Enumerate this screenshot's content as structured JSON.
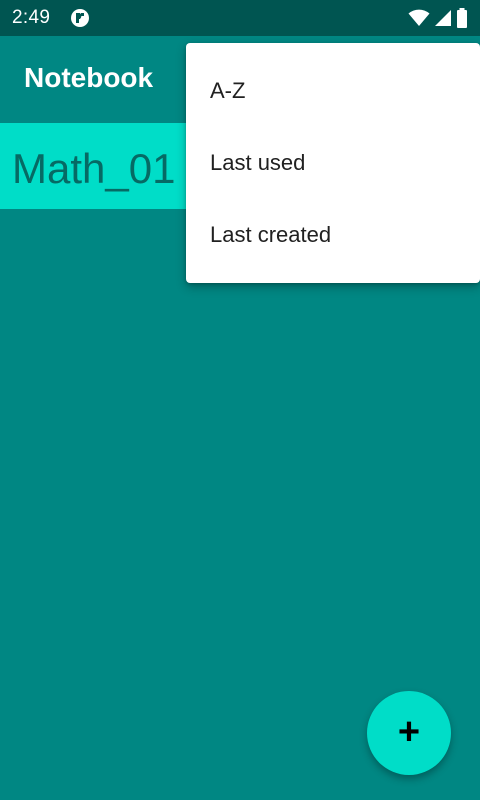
{
  "status_bar": {
    "time": "2:49",
    "icons": [
      "app-notification-icon",
      "wifi-icon",
      "signal-icon",
      "battery-icon"
    ]
  },
  "app_bar": {
    "title": "Notebook"
  },
  "notebooks": [
    {
      "name": "Math_01"
    }
  ],
  "sort_menu": {
    "items": [
      {
        "label": "A-Z"
      },
      {
        "label": "Last used"
      },
      {
        "label": "Last created"
      }
    ]
  },
  "fab": {
    "icon": "add-icon",
    "symbol": "+"
  },
  "colors": {
    "status_bar": "#005551",
    "primary": "#008783",
    "accent": "#00ddc8",
    "item_text": "#066a64",
    "menu_bg": "#ffffff",
    "menu_text": "#212121"
  }
}
